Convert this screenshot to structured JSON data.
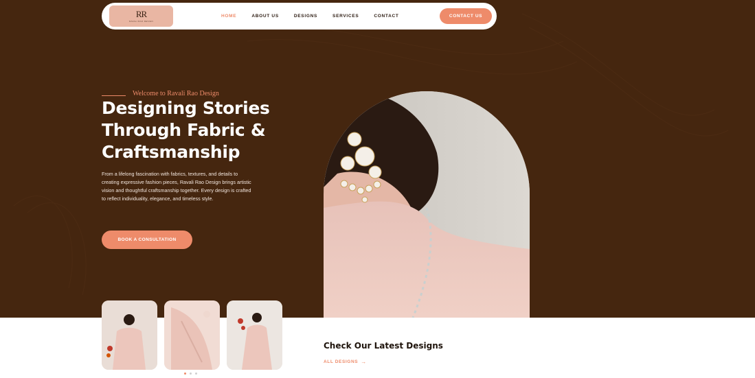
{
  "brand": {
    "logo_mark": "RR",
    "logo_small": "RAVALI RAO DESIGN"
  },
  "nav": {
    "items": [
      {
        "label": "HOME",
        "active": true
      },
      {
        "label": "ABOUT US",
        "active": false
      },
      {
        "label": "DESIGNS",
        "active": false
      },
      {
        "label": "SERVICES",
        "active": false
      },
      {
        "label": "CONTACT",
        "active": false
      }
    ],
    "contact_button": "CONTACT US"
  },
  "hero": {
    "eyebrow": "Welcome to Ravali Rao Design",
    "headline": "Designing Stories Through Fabric & Craftsmanship",
    "intro": "From a lifelong fascination with fabrics, textures, and details to creating expressive fashion pieces, Ravali Rao Design brings artistic vision and thoughtful craftsmanship together. Every design is crafted to reflect individuality, elegance, and timeless style.",
    "cta": "BOOK A CONSULTATION"
  },
  "latest": {
    "title": "Check Our Latest Designs",
    "link": "ALL DESIGNS",
    "link_icon": "arrow-right-icon"
  },
  "carousel": {
    "dots": [
      true,
      false,
      false
    ]
  },
  "colors": {
    "hero_bg": "#45260f",
    "accent": "#ee8b6a",
    "logo_bg": "#e9b6a3"
  }
}
